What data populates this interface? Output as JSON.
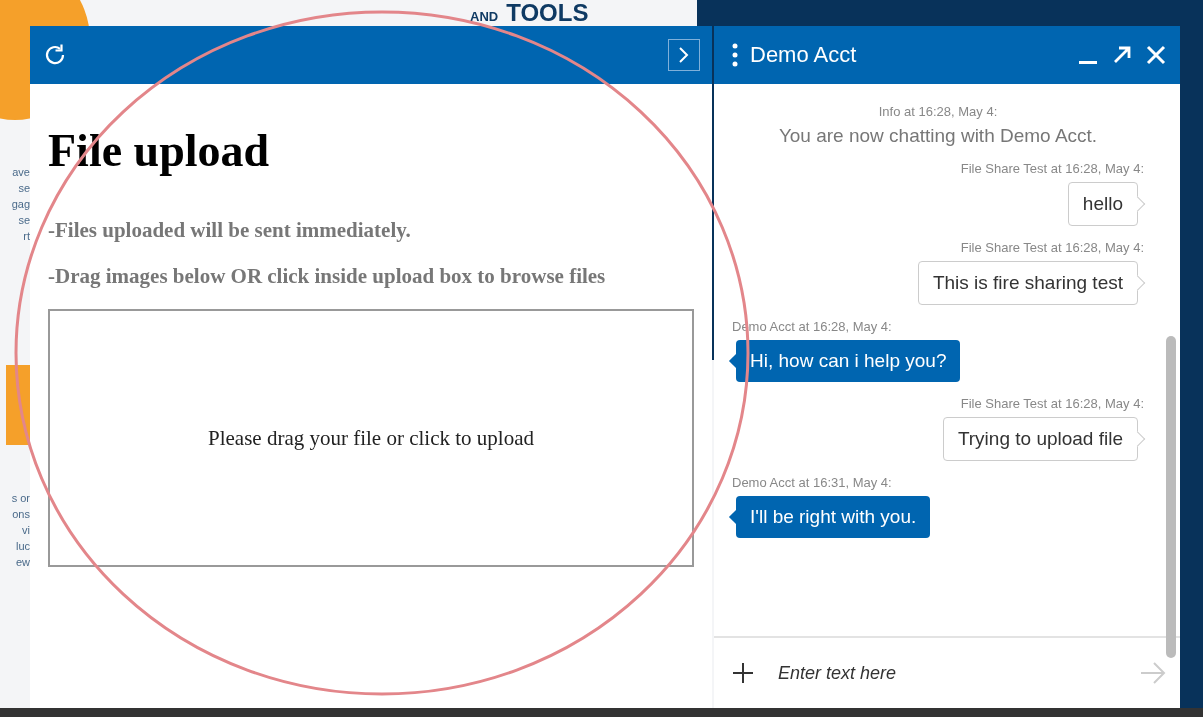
{
  "background_page": {
    "heading": [
      "AND",
      "TOOLS"
    ],
    "text_fragments_top": [
      "ave",
      "se",
      "gag",
      "se",
      "rt"
    ],
    "text_fragments_bottom": [
      "s or",
      "ons",
      "vi",
      "luc",
      "ew"
    ]
  },
  "upload_panel": {
    "title": "File upload",
    "notes": [
      "-Files uploaded will be sent immediately.",
      "-Drag images below OR click inside upload box to browse files"
    ],
    "drop_zone": {
      "label": "Please drag your file or click to upload"
    }
  },
  "chat": {
    "title": "Demo Acct",
    "messages": [
      {
        "kind": "info",
        "meta": "Info at 16:28, May 4:",
        "text": "You are now chatting with Demo Acct."
      },
      {
        "kind": "sent",
        "meta": "File Share Test at 16:28, May 4:",
        "text": "hello"
      },
      {
        "kind": "sent",
        "meta": "File Share Test at 16:28, May 4:",
        "text": "This is fire sharing test"
      },
      {
        "kind": "received",
        "meta": "Demo Acct at 16:28, May 4:",
        "text": "Hi, how can i help you?"
      },
      {
        "kind": "sent",
        "meta": "File Share Test at 16:28, May 4:",
        "text": "Trying to upload file"
      },
      {
        "kind": "received",
        "meta": "Demo Acct at 16:31, May 4:",
        "text": "I'll be right with you."
      }
    ],
    "input": {
      "placeholder": "Enter text here"
    }
  }
}
